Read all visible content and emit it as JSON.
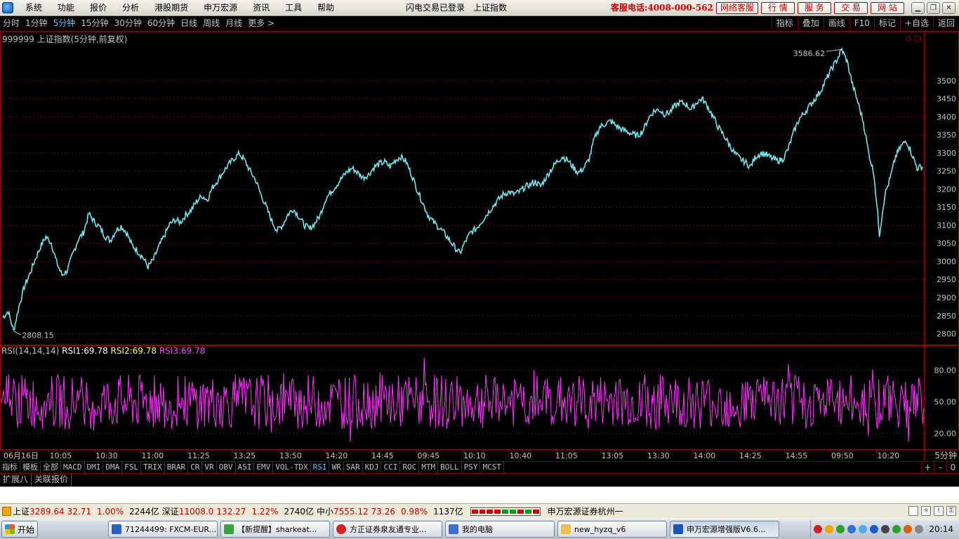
{
  "menubar": {
    "items": [
      "系统",
      "功能",
      "报价",
      "分析",
      "港股期货",
      "申万宏源",
      "资讯",
      "工具",
      "帮助"
    ],
    "status": "闪电交易已登录",
    "current_symbol": "上证指数",
    "hotline": "客服电话:4008-000-562",
    "buttons": [
      "网络客服",
      "行 情",
      "服 务",
      "交 易",
      "网 站"
    ]
  },
  "periods": {
    "items": [
      "分时",
      "1分钟",
      "5分钟",
      "15分钟",
      "30分钟",
      "60分钟",
      "日线",
      "周线",
      "月线",
      "更多 >"
    ],
    "active": "5分钟"
  },
  "right_toolbar": [
    "指标",
    "叠加",
    "画线",
    "F10",
    "标记",
    "+自选",
    "返回"
  ],
  "chart_header": "999999 上证指数(5分钟,前复权)",
  "chart_data": [
    {
      "type": "line",
      "series": [
        {
          "values": [
            2845,
            2862,
            2808,
            2875,
            2930,
            2965,
            3005,
            3040,
            3068,
            3052,
            2998,
            2962,
            2975,
            3020,
            3060,
            3080,
            3132,
            3110,
            3095,
            3070,
            3058,
            3085,
            3098,
            3080,
            3045,
            3030,
            3012,
            2985,
            3005,
            3040,
            3070,
            3102,
            3115,
            3108,
            3128,
            3142,
            3165,
            3182,
            3170,
            3205,
            3225,
            3248,
            3268,
            3285,
            3298,
            3278,
            3250,
            3225,
            3185,
            3150,
            3112,
            3085,
            3100,
            3130,
            3145,
            3125,
            3102,
            3090,
            3105,
            3128,
            3172,
            3192,
            3210,
            3230,
            3248,
            3258,
            3245,
            3232,
            3240,
            3260,
            3270,
            3275,
            3262,
            3280,
            3290,
            3275,
            3240,
            3200,
            3165,
            3130,
            3110,
            3095,
            3080,
            3060,
            3040,
            3022,
            3055,
            3080,
            3090,
            3110,
            3130,
            3150,
            3168,
            3185,
            3192,
            3186,
            3192,
            3205,
            3212,
            3220,
            3208,
            3232,
            3255,
            3275,
            3290,
            3280,
            3262,
            3245,
            3258,
            3282,
            3340,
            3372,
            3380,
            3388,
            3376,
            3365,
            3360,
            3352,
            3348,
            3360,
            3395,
            3415,
            3420,
            3408,
            3412,
            3430,
            3440,
            3435,
            3420,
            3440,
            3450,
            3430,
            3402,
            3372,
            3350,
            3325,
            3300,
            3285,
            3275,
            3262,
            3290,
            3300,
            3295,
            3285,
            3278,
            3282,
            3310,
            3355,
            3392,
            3410,
            3430,
            3450,
            3470,
            3500,
            3530,
            3555,
            3586,
            3552,
            3488,
            3440,
            3385,
            3300,
            3240,
            3075,
            3185,
            3230,
            3290,
            3318,
            3335,
            3298,
            3258,
            3262
          ],
          "color": "#6fe6f2"
        }
      ],
      "ylim": [
        2770,
        3620
      ],
      "yticks": [
        "3500",
        "3450",
        "3400",
        "3350",
        "3300",
        "3250",
        "3200",
        "3150",
        "3100",
        "3050",
        "3000",
        "2950",
        "2900",
        "2850",
        "2800"
      ],
      "annotations": [
        {
          "text": "3586.62",
          "value": 3586.62
        },
        {
          "text": "2808.15",
          "value": 2808.15
        }
      ],
      "grid": true
    },
    {
      "type": "line",
      "title": "RSI(14,14,14)",
      "legend": [
        {
          "name": "RSI1:",
          "value": "69.78",
          "color": "#ffffff"
        },
        {
          "name": "RSI2:",
          "value": "69.78",
          "color": "#ffff40"
        },
        {
          "name": "RSI3:",
          "value": "69.78",
          "color": "#ff40ff"
        }
      ],
      "series_color": "#ff30ff",
      "ylim": [
        5,
        95
      ],
      "yticks": [
        "80.00",
        "50.00",
        "20.00"
      ],
      "grid": true
    }
  ],
  "x_axis": {
    "labels": [
      "06月16日",
      "10:05",
      "10:30",
      "11:00",
      "11:25",
      "13:25",
      "13:50",
      "14:20",
      "14:45",
      "09:45",
      "10:10",
      "10:40",
      "11:05",
      "13:05",
      "13:30",
      "14:00",
      "14:25",
      "14:55",
      "09:50",
      "10:20"
    ]
  },
  "period_tag": "5分钟",
  "indicators": {
    "items": [
      "指标",
      "模板",
      "全部",
      "MACD",
      "DMI",
      "DMA",
      "FSL",
      "TRIX",
      "BRAR",
      "CR",
      "VR",
      "OBV",
      "ASI",
      "EMV",
      "VOL-TDX",
      "RSI",
      "WR",
      "SAR",
      "KDJ",
      "CCI",
      "ROC",
      "MTM",
      "BOLL",
      "PSY",
      "MCST"
    ],
    "active": "RSI",
    "controls": [
      "+",
      "-",
      "0"
    ]
  },
  "extension": [
    "扩展八",
    "关联报价"
  ],
  "status": {
    "sh_name": "上证",
    "sh_value": "3289.64",
    "sh_change": "32.71",
    "sh_pct": "1.00%",
    "sh_amount": "2244亿",
    "sz_name": "深证",
    "sz_value": "11008.0",
    "sz_change": "132.27",
    "sz_pct": "1.22%",
    "sz_amount": "2740亿",
    "zx_name": "中小",
    "zx_value": "7555.12",
    "zx_change": "73.26",
    "zx_pct": "0.98%",
    "zx_amount": "1137亿",
    "broker": "申万宏源证券杭州一"
  },
  "taskbar": {
    "start": "开始",
    "tasks": [
      {
        "label": "71244499: FXCM-EUR...",
        "color": "#2a5fc4"
      },
      {
        "label": "【新提醒】sharkeat...",
        "color": "#3aa33a"
      },
      {
        "label": "方正证券泉友通专业...",
        "color": "#d42020"
      },
      {
        "label": "我的电脑",
        "color": "#3c6fd0"
      },
      {
        "label": "new_hyzq_v6",
        "color": "#e8c050"
      },
      {
        "label": "申万宏源增强版V6.6...",
        "color": "#1a56b8"
      }
    ],
    "clock": "20:14"
  }
}
